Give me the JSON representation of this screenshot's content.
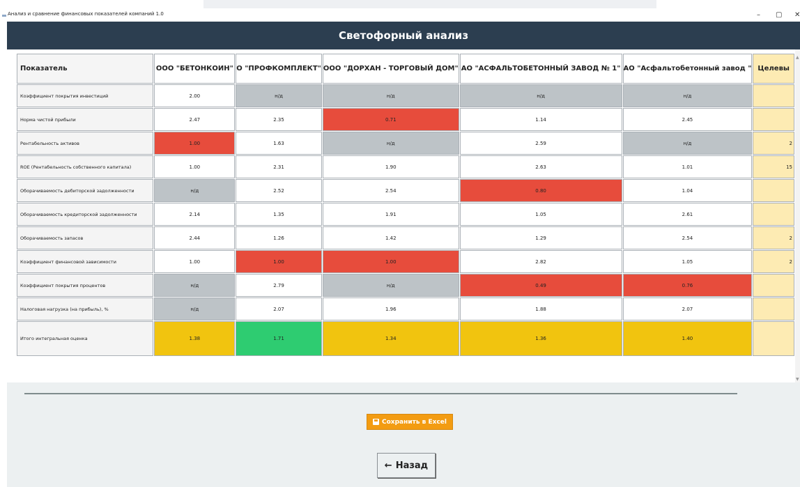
{
  "window": {
    "title": "Анализ и сравнение финансовых показателей компаний 1.0",
    "minimize": "–",
    "maximize": "▢",
    "close": "✕"
  },
  "header": {
    "title": "Светофорный анализ"
  },
  "table": {
    "columns": [
      "Показатель",
      "ООО \"БЕТОНКОИН\"",
      "О \"ПРОФКОМПЛЕКТ\"",
      "ООО \"ДОРХАН - ТОРГОВЫЙ ДОМ\"",
      "АО \"АСФАЛЬТОБЕТОННЫЙ ЗАВОД № 1\"",
      "АО \"Асфальтобетонный завод \"",
      "Целевы"
    ],
    "rows": [
      {
        "label": "Коэффициент покрытия инвестиций",
        "values": [
          "2.00",
          "н/д",
          "н/д",
          "н/д",
          "н/д"
        ],
        "status": [
          "white",
          "na",
          "na",
          "na",
          "na"
        ],
        "target": ""
      },
      {
        "label": "Норма чистой прибыли",
        "values": [
          "2.47",
          "2.35",
          "0.71",
          "1.14",
          "2.45"
        ],
        "status": [
          "white",
          "white",
          "red",
          "white",
          "white"
        ],
        "target": ""
      },
      {
        "label": "Рентабельность активов",
        "values": [
          "1.00",
          "1.63",
          "н/д",
          "2.59",
          "н/д"
        ],
        "status": [
          "red",
          "white",
          "na",
          "white",
          "na"
        ],
        "target": "2"
      },
      {
        "label": "ROE (Рентабельность собственного капитала)",
        "values": [
          "1.00",
          "2.31",
          "1.90",
          "2.63",
          "1.01"
        ],
        "status": [
          "white",
          "white",
          "white",
          "white",
          "white"
        ],
        "target": "15"
      },
      {
        "label": "Оборачиваемость дебиторской задолженности",
        "values": [
          "н/д",
          "2.52",
          "2.54",
          "0.80",
          "1.04"
        ],
        "status": [
          "na",
          "white",
          "white",
          "red",
          "white"
        ],
        "target": ""
      },
      {
        "label": "Оборачиваемость кредиторской задолженности",
        "values": [
          "2.14",
          "1.35",
          "1.91",
          "1.05",
          "2.61"
        ],
        "status": [
          "white",
          "white",
          "white",
          "white",
          "white"
        ],
        "target": ""
      },
      {
        "label": "Оборачиваемость запасов",
        "values": [
          "2.44",
          "1.26",
          "1.42",
          "1.29",
          "2.54"
        ],
        "status": [
          "white",
          "white",
          "white",
          "white",
          "white"
        ],
        "target": "2"
      },
      {
        "label": "Коэффициент финансовой зависимости",
        "values": [
          "1.00",
          "1.00",
          "1.00",
          "2.82",
          "1.05"
        ],
        "status": [
          "white",
          "red",
          "red",
          "white",
          "white"
        ],
        "target": "2"
      },
      {
        "label": "Коэффициент покрытия процентов",
        "values": [
          "н/д",
          "2.79",
          "н/д",
          "0.49",
          "0.76"
        ],
        "status": [
          "na",
          "white",
          "na",
          "red",
          "red"
        ],
        "target": ""
      },
      {
        "label": "Налоговая нагрузка (на прибыль), %",
        "values": [
          "н/д",
          "2.07",
          "1.96",
          "1.88",
          "2.07"
        ],
        "status": [
          "na",
          "white",
          "white",
          "white",
          "white"
        ],
        "target": ""
      },
      {
        "label": "Итого интегральная оценка",
        "values": [
          "1.38",
          "1.71",
          "1.34",
          "1.36",
          "1.40"
        ],
        "status": [
          "yel",
          "grn",
          "yel",
          "yel",
          "yel"
        ],
        "target": "",
        "total": true
      }
    ]
  },
  "buttons": {
    "save_label": "Сохранить в Excel",
    "back_label": "Назад",
    "back_arrow": "←"
  },
  "colors": {
    "header": "#2c3e50",
    "red": "#e74c3c",
    "yellow": "#f1c40f",
    "green": "#2ecc71",
    "na": "#bdc3c7",
    "target": "#fdebb3",
    "save_button": "#f39c12"
  }
}
